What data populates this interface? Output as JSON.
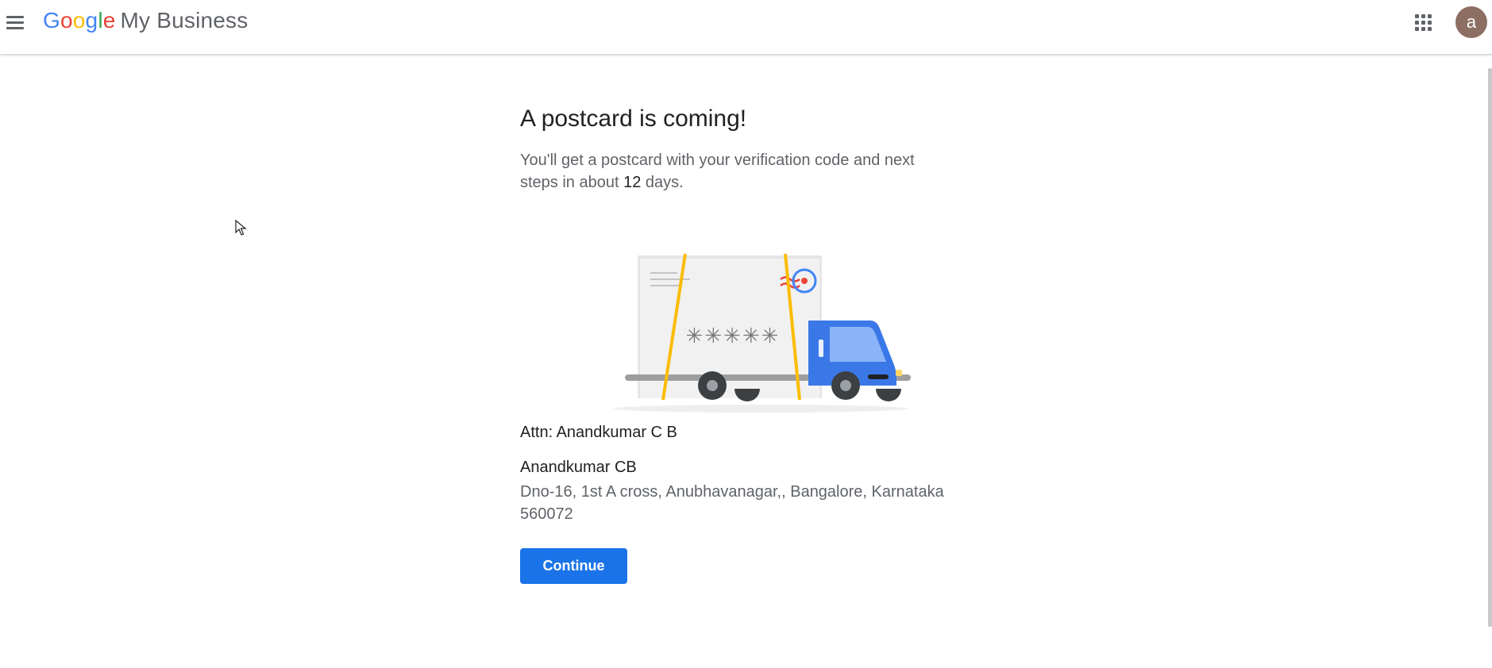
{
  "header": {
    "logo_letters": [
      "G",
      "o",
      "o",
      "g",
      "l",
      "e"
    ],
    "product_name": "My Business",
    "avatar_initial": "a"
  },
  "main": {
    "title": "A postcard is coming!",
    "subtitle_before": "You'll get a postcard with your verification code and next steps in about ",
    "subtitle_days": "12",
    "subtitle_after": " days.",
    "code_placeholder": "✳✳✳✳✳",
    "attn": "Attn: Anandkumar C B",
    "business_name": "Anandkumar CB",
    "address": "Dno-16, 1st A cross, Anubhavanagar,, Bangalore, Karnataka 560072",
    "continue_label": "Continue"
  },
  "colors": {
    "accent": "#1a73e8",
    "google_blue": "#4285F4",
    "google_red": "#EA4335",
    "google_yellow": "#FBBC05",
    "google_green": "#34A853",
    "truck_blue": "#3b78e7",
    "avatar_bg": "#8d6e63"
  },
  "icons": {
    "menu": "menu-icon",
    "apps": "apps-grid-icon",
    "cursor": "mouse-pointer-icon"
  }
}
